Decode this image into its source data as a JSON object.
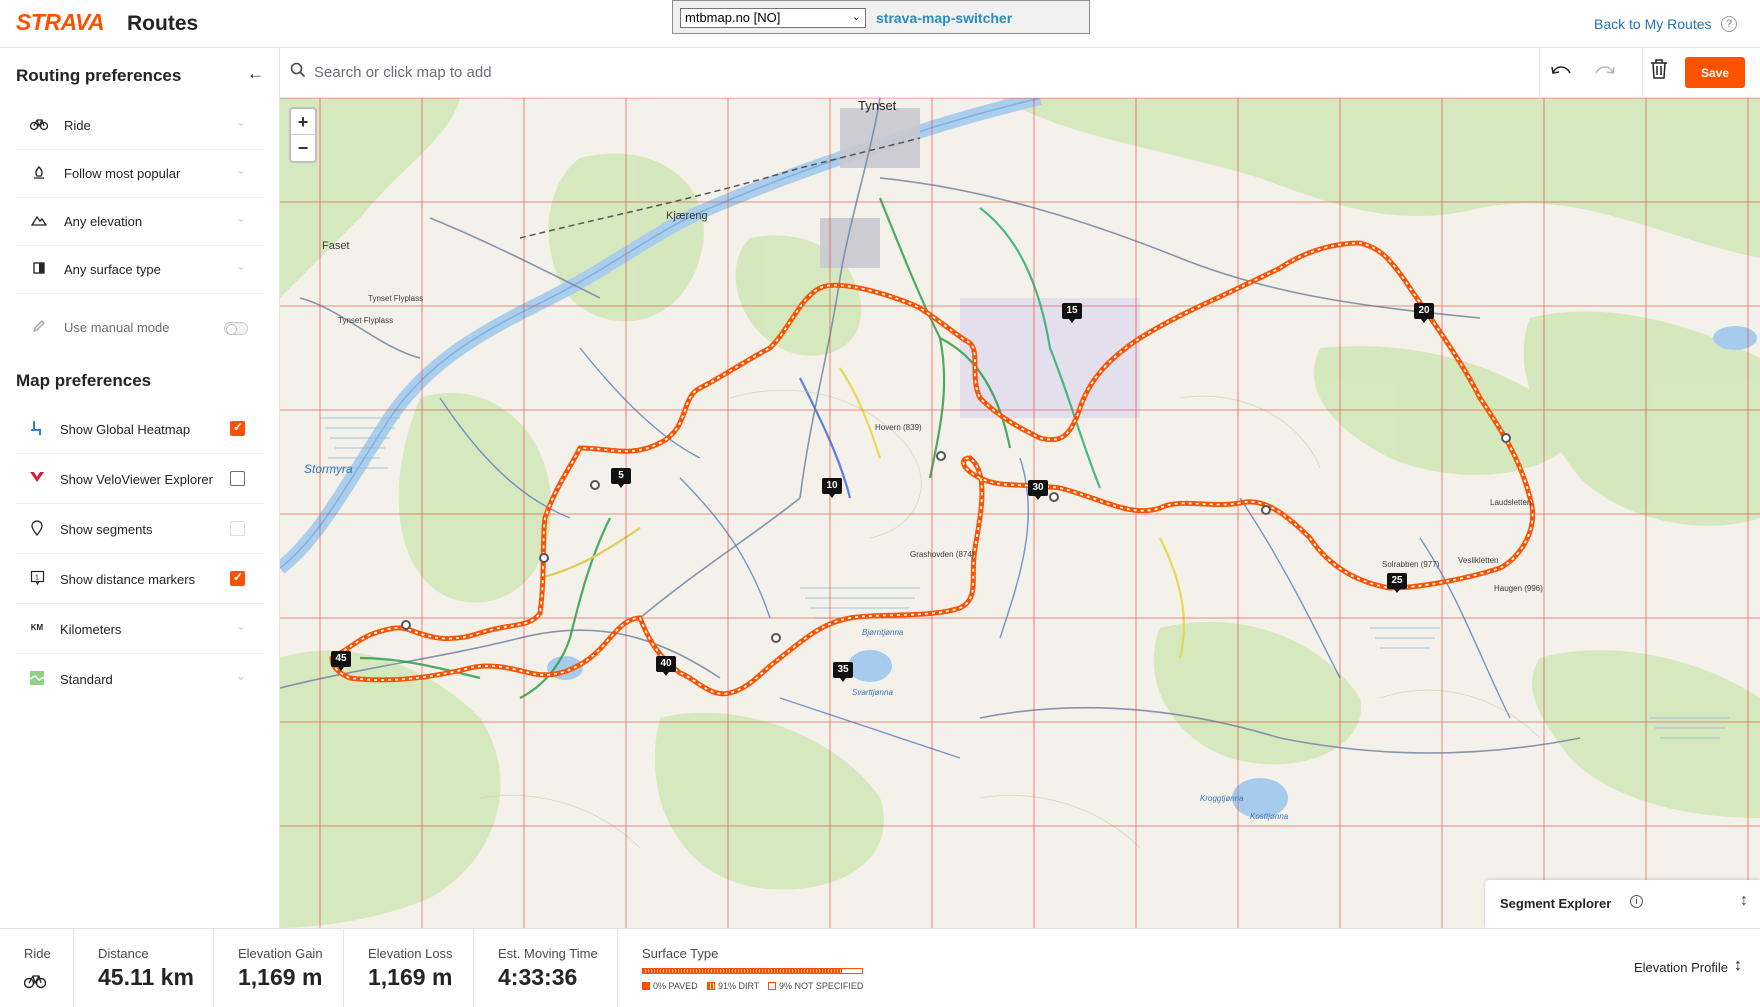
{
  "header": {
    "logo": "STRAVA",
    "title": "Routes",
    "back_link": "Back to My Routes",
    "help_icon": "?"
  },
  "extension": {
    "select_value": "mtbmap.no [NO]",
    "link": "strava-map-switcher"
  },
  "toolbar": {
    "search_placeholder": "Search or click map to add",
    "save_label": "Save"
  },
  "routing_preferences": {
    "title": "Routing preferences",
    "items": [
      {
        "label": "Ride",
        "icon": "bike-icon"
      },
      {
        "label": "Follow most popular",
        "icon": "popularity-icon"
      },
      {
        "label": "Any elevation",
        "icon": "elevation-icon"
      },
      {
        "label": "Any surface type",
        "icon": "surface-icon"
      }
    ],
    "manual_mode": {
      "label": "Use manual mode",
      "enabled": false
    }
  },
  "map_preferences": {
    "title": "Map preferences",
    "items": [
      {
        "label": "Show Global Heatmap",
        "icon": "heatmap-icon",
        "checked": true
      },
      {
        "label": "Show VeloViewer Explorer",
        "icon": "veloviewer-icon",
        "checked": false
      },
      {
        "label": "Show segments",
        "icon": "segments-icon",
        "checked": false,
        "disabled": true
      },
      {
        "label": "Show distance markers",
        "icon": "distance-marker-icon",
        "checked": true
      },
      {
        "label": "Kilometers",
        "icon": "units-icon",
        "icon_text": "KM"
      },
      {
        "label": "Standard",
        "icon": "map-style-icon"
      }
    ]
  },
  "map": {
    "zoom_in": "+",
    "zoom_out": "−",
    "labels": {
      "tynset": "Tynset",
      "kjaereng": "Kjæreng",
      "faset": "Faset",
      "tynset_flyplass_a": "Tynset Flyplass",
      "tynset_flyplass_b": "Tynset Flyplass",
      "stormyra": "Stormyra",
      "hovern": "Hovern (839)",
      "grashovden": "Grashovden (874)",
      "solrabben": "Solrabben (977)",
      "bjorntjonna": "Bjørntjønna",
      "svarttjonna": "Svarttjønna",
      "kroggtjonna": "Kroggtjønna",
      "kosttjonna": "Kosttjønna",
      "veslikletten": "Veslikletten",
      "laudsletten": "Laudsletten",
      "haugen": "Haugen (996)"
    },
    "distance_markers": [
      "5",
      "10",
      "15",
      "20",
      "25",
      "30",
      "35",
      "40",
      "45"
    ],
    "colors": {
      "route": "#fc5200",
      "grid": "#e53935",
      "water": "#a7cbec"
    }
  },
  "segment_explorer": {
    "title": "Segment Explorer"
  },
  "stats": {
    "sport_label": "Ride",
    "distance": {
      "label": "Distance",
      "value": "45.11 km"
    },
    "elevation_gain": {
      "label": "Elevation Gain",
      "value": "1,169 m"
    },
    "elevation_loss": {
      "label": "Elevation Loss",
      "value": "1,169 m"
    },
    "moving_time": {
      "label": "Est. Moving Time",
      "value": "4:33:36"
    },
    "surface": {
      "label": "Surface Type",
      "paved_pct": 0,
      "dirt_pct": 91,
      "unspecified_pct": 9,
      "legend": [
        "0% PAVED",
        "91% DIRT",
        "9% NOT SPECIFIED"
      ]
    },
    "elevation_profile": "Elevation Profile"
  }
}
